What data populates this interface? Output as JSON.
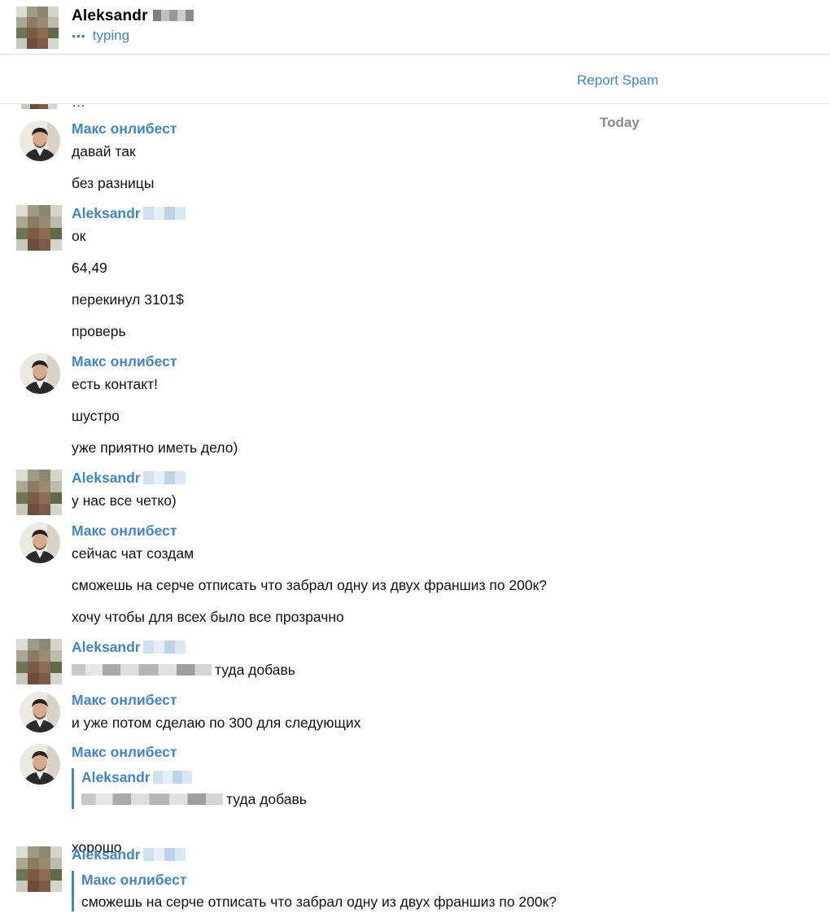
{
  "header": {
    "name": "Aleksandr",
    "status_dots": "•••",
    "status": "typing"
  },
  "spam_bar": {
    "label": "Report Spam"
  },
  "chat": {
    "date_separator": "Today",
    "cutoff_text": "…",
    "groups": [
      {
        "sender": "Макс онлибест",
        "messages": [
          "давай так",
          "без разницы"
        ]
      },
      {
        "sender": "Aleksandr",
        "messages": [
          "ок",
          "64,49",
          "перекинул 3101$",
          "проверь"
        ]
      },
      {
        "sender": "Макс онлибест",
        "messages": [
          "есть контакт!",
          "шустро",
          "уже приятно иметь дело)"
        ]
      },
      {
        "sender": "Aleksandr",
        "messages": [
          "у нас все четко)"
        ]
      },
      {
        "sender": "Макс онлибест",
        "messages": [
          "сейчас чат создам",
          "сможешь на серче отписать что забрал одну из двух франшиз по 200к?",
          "хочу чтобы для всех было все прозрачно"
        ]
      },
      {
        "sender": "Aleksandr",
        "messages": [
          "туда добавь"
        ]
      },
      {
        "sender": "Макс онлибест",
        "messages": [
          "и уже потом сделаю по 300 для следующих"
        ]
      },
      {
        "sender": "Макс онлибест",
        "quote": {
          "sender": "Aleksandr",
          "text": "туда добавь"
        },
        "messages": [
          "хорошо"
        ]
      },
      {
        "sender": "Aleksandr",
        "quote": {
          "sender": "Макс онлибест",
          "text": "сможешь на серче отписать что забрал одну из двух франшиз по 200к?"
        },
        "messages": []
      }
    ]
  },
  "colors": {
    "accent": "#3f86c8",
    "muted": "#8b8b8b",
    "divider": "#e4e4e4"
  },
  "icons": {
    "typing_indicator": "typing-dots-icon"
  }
}
